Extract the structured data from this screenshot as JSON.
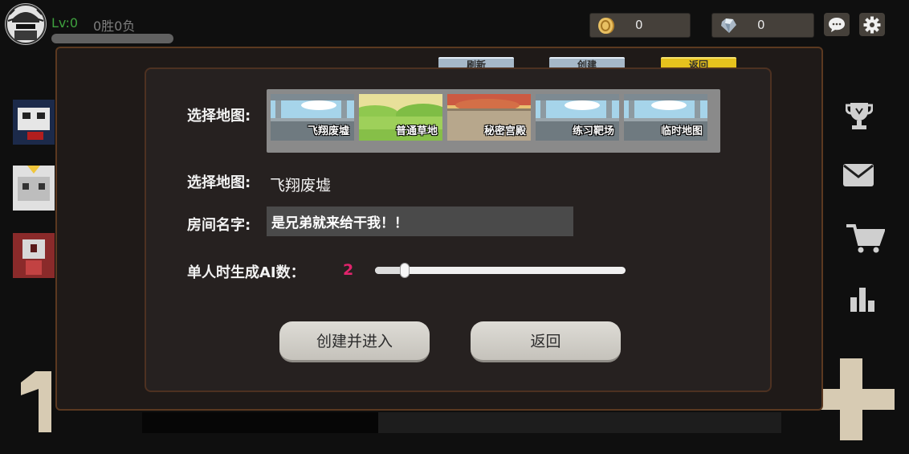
{
  "header": {
    "level": "Lv:0",
    "record": "0胜0负",
    "gold": "0",
    "gems": "0"
  },
  "dialog": {
    "tabs": {
      "refresh": "刷新",
      "create": "创建",
      "back": "返回"
    },
    "select_map_label": "选择地图:",
    "maps": [
      "飞翔废墟",
      "普通草地",
      "秘密宫殿",
      "练习靶场",
      "临时地图"
    ],
    "selected_map_label": "选择地图:",
    "selected_map_value": "飞翔废墟",
    "room_name_label": "房间名字:",
    "room_name_value": "是兄弟就来给干我！！",
    "ai_count_label": "单人时生成AI数：",
    "ai_count_value": "2",
    "ai_slider_fraction": 0.12,
    "create_enter_label": "创建并进入",
    "return_label": "返回"
  },
  "colors": {
    "level": "#3ea03e",
    "ai_value": "#e0246c",
    "back_tab": "#e7c21d",
    "panel_border": "#5b3920"
  },
  "icons": [
    "avatar",
    "coin-icon",
    "diamond-icon",
    "chat-icon",
    "gear-icon",
    "trophy-icon",
    "mail-icon",
    "cart-icon",
    "chart-icon",
    "plus-icon"
  ]
}
